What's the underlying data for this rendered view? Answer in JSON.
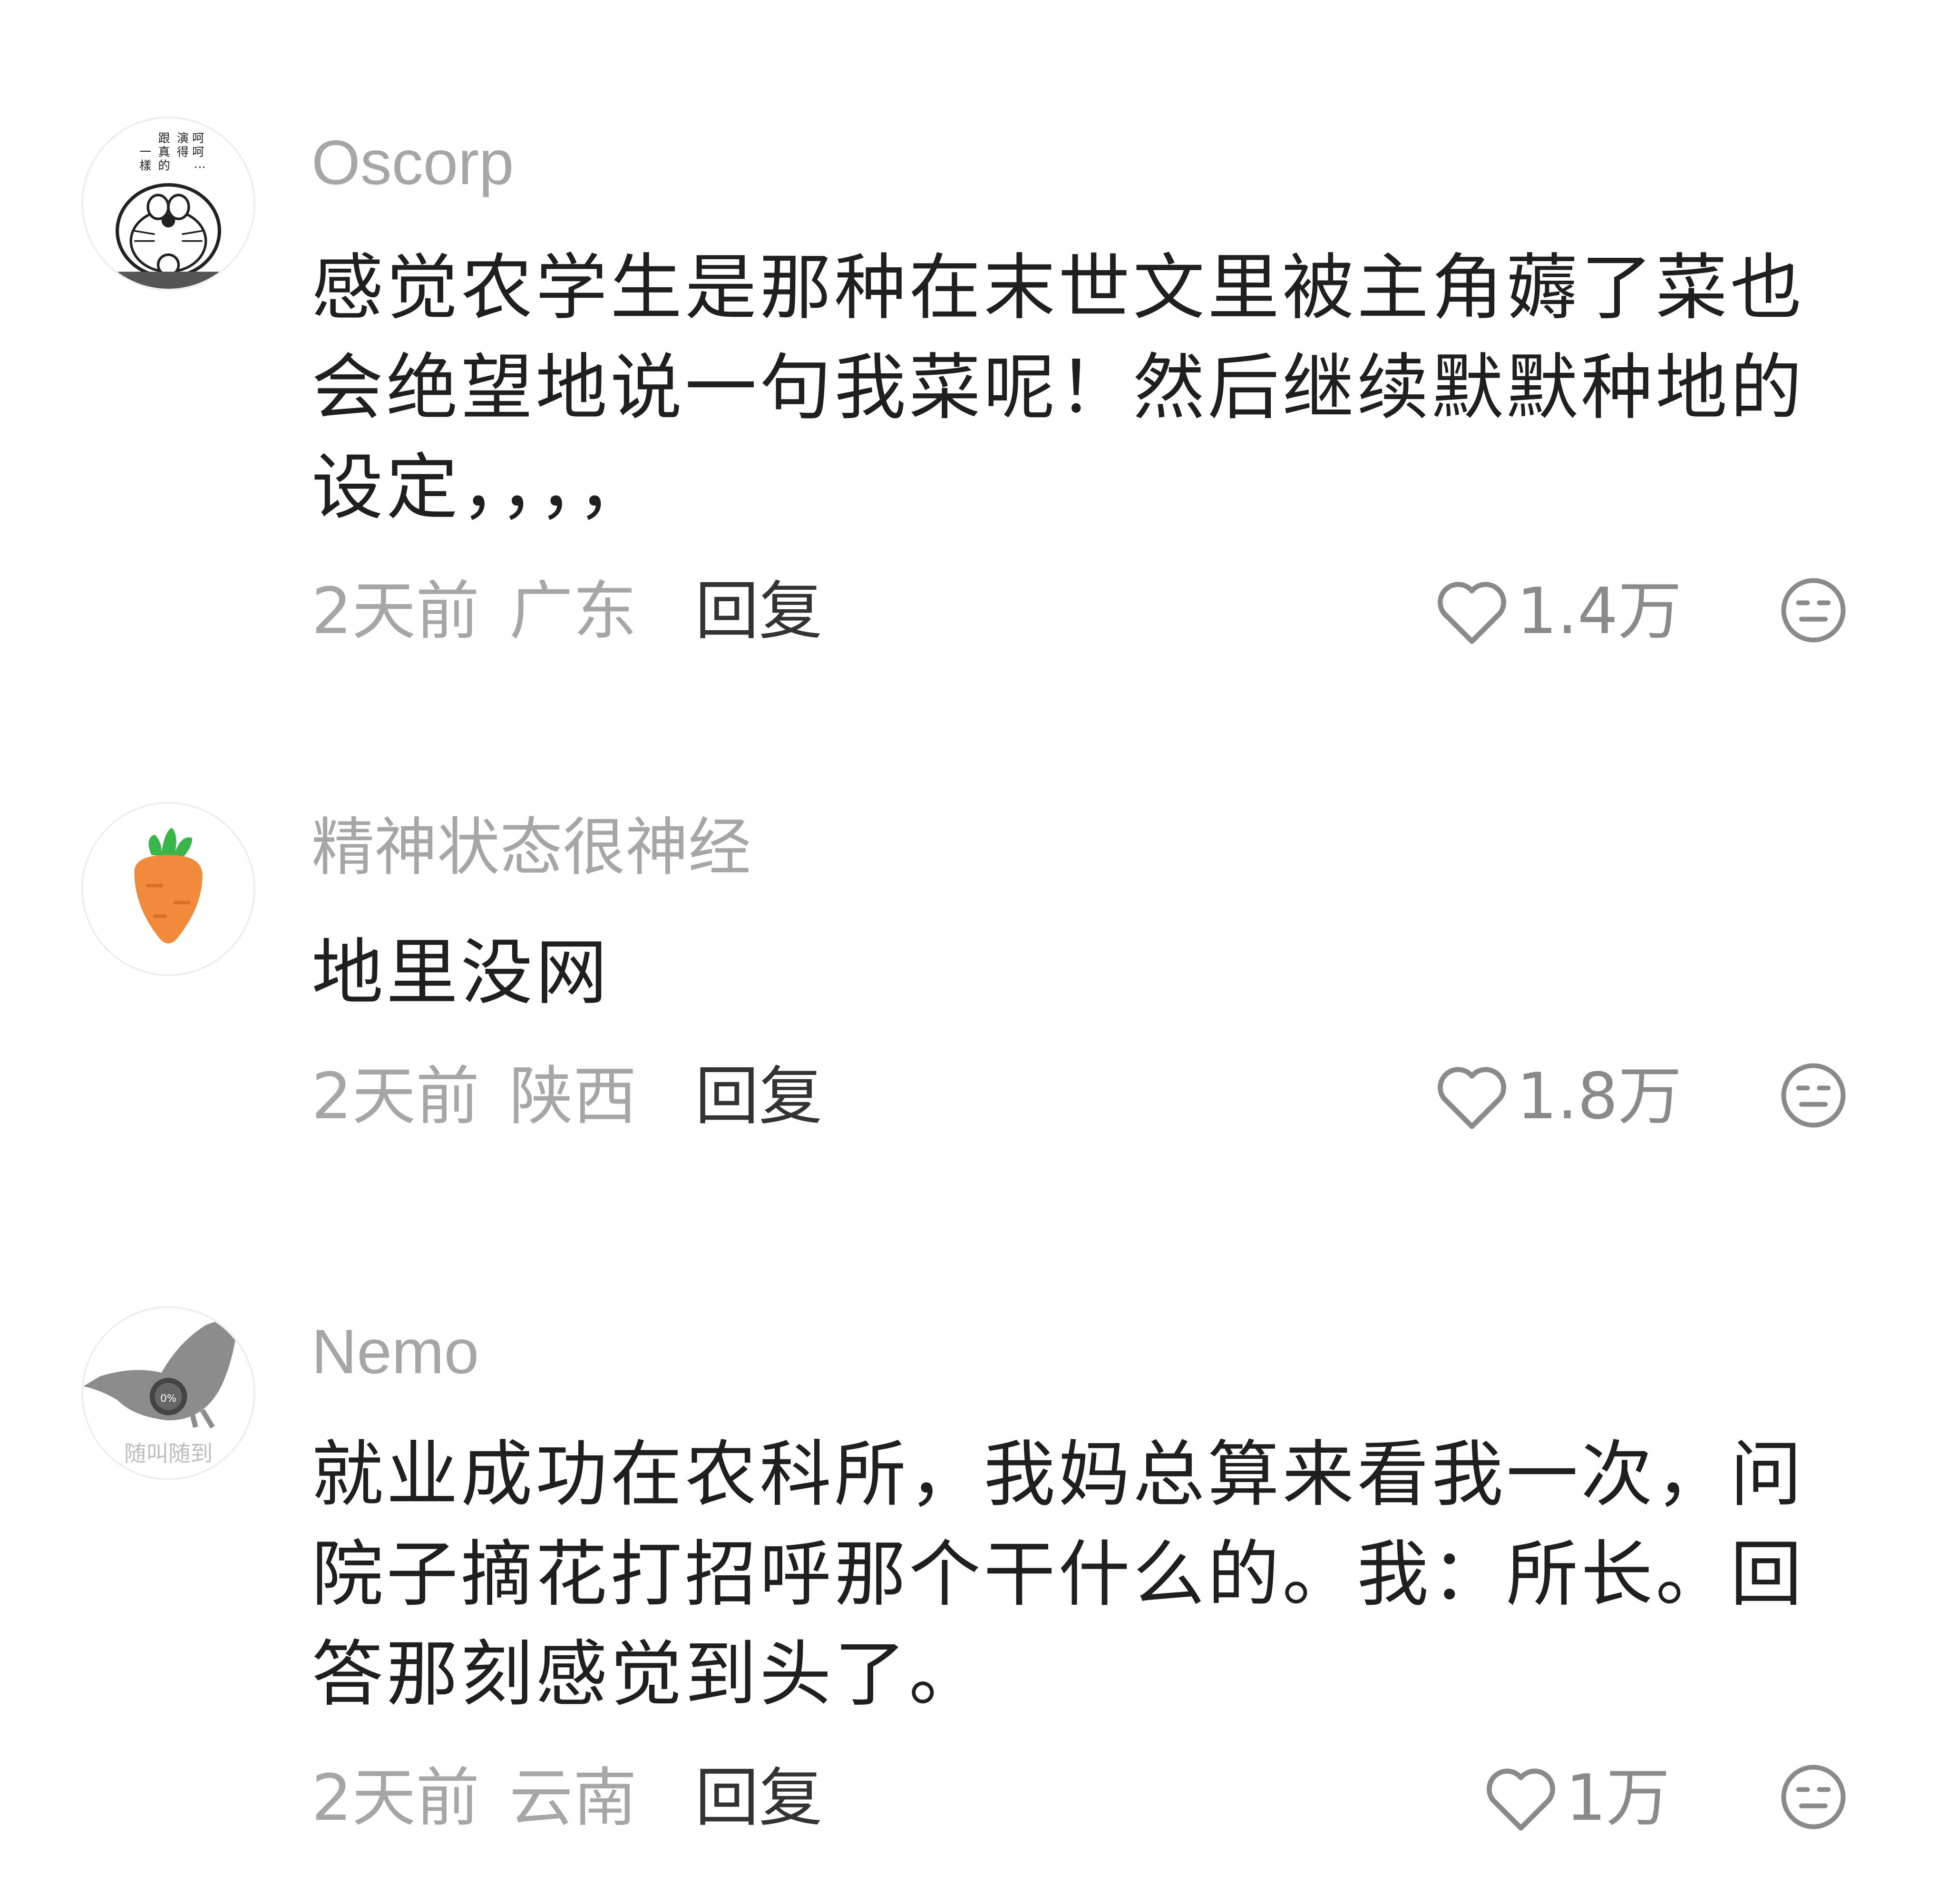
{
  "comments": [
    {
      "username": "Oscorp",
      "avatar_icon": "doraemon-manga-avatar-icon",
      "avatar_text": "呵呵…演得跟真的一样。",
      "content": "感觉农学生是那种在末世文里被主角薅了菜也会绝望地说一句我菜呢！然后继续默默种地的设定，，，，",
      "time": "2天前",
      "location": "广东",
      "reply_label": "回复",
      "likes": "1.4万"
    },
    {
      "username": "精神状态很神经",
      "avatar_icon": "carrot-avatar-icon",
      "content": "地里没网",
      "time": "2天前",
      "location": "陕西",
      "reply_label": "回复",
      "likes": "1.8万"
    },
    {
      "username": "Nemo",
      "avatar_icon": "pigeon-avatar-icon",
      "avatar_text": "随叫随到",
      "avatar_badge": "0%",
      "content": "就业成功在农科所，我妈总算来看我一次，问院子摘花打招呼那个干什么的。我：所长。回答那刻感觉到头了。",
      "time": "2天前",
      "location": "云南",
      "reply_label": "回复",
      "likes": "1万"
    }
  ],
  "icons": {
    "like": "heart-outline-icon",
    "reaction": "neutral-face-icon"
  },
  "colors": {
    "username": "#a6a6a6",
    "content": "#1f1f1f",
    "meta": "#a6a6a6",
    "reply": "#333333",
    "icon": "#8a8a8a",
    "carrot": "#f28a3c",
    "carrot_leaf": "#3bb54a"
  }
}
